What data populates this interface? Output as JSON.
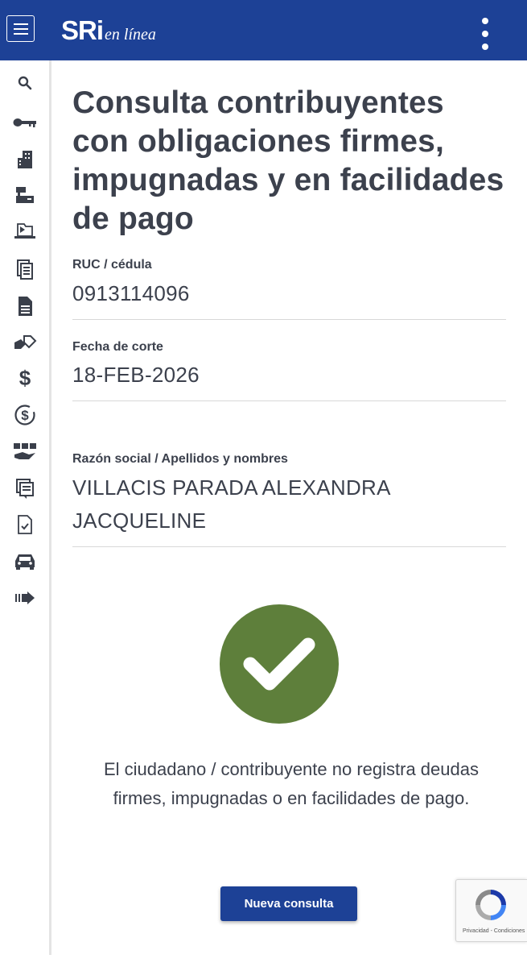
{
  "header": {
    "logo_main": "SRi",
    "logo_sub": "en línea",
    "menu_icon": "hamburger-menu-icon",
    "more_icon": "kebab-menu-icon"
  },
  "sidebar": {
    "items": [
      {
        "icon": "search-icon"
      },
      {
        "icon": "key-icon"
      },
      {
        "icon": "buildings-icon"
      },
      {
        "icon": "cash-register-icon"
      },
      {
        "icon": "laptop-folder-icon"
      },
      {
        "icon": "document-list-icon"
      },
      {
        "icon": "document-icon"
      },
      {
        "icon": "hand-tag-icon"
      },
      {
        "icon": "dollar-icon"
      },
      {
        "icon": "dollar-circle-icon"
      },
      {
        "icon": "tax-hand-icon"
      },
      {
        "icon": "forms-icon"
      },
      {
        "icon": "document-check-icon"
      },
      {
        "icon": "car-icon"
      },
      {
        "icon": "arrow-right-icon"
      }
    ]
  },
  "main": {
    "title": "Consulta contribuyentes con obligaciones firmes, impugnadas y en facilidades de pago",
    "ruc_label": "RUC / cédula",
    "ruc_value": "0913114096",
    "fecha_label": "Fecha de corte",
    "fecha_value": "18-FEB-2026",
    "razon_label": "Razón social / Apellidos y nombres",
    "razon_value_line1": "VILLACIS PARADA ALEXANDRA",
    "razon_value_line2": "JACQUELINE",
    "status_icon": "check-icon",
    "status_color": "#5e7f3b",
    "message": "El ciudadano / contribuyente no registra deudas firmes, impugnadas o en facilidades de pago.",
    "button_label": "Nueva consulta"
  },
  "recaptcha": {
    "legal": "Privacidad - Condiciones"
  },
  "colors": {
    "brand": "#1d4196",
    "text": "#3c414d",
    "success": "#5e7f3b"
  }
}
